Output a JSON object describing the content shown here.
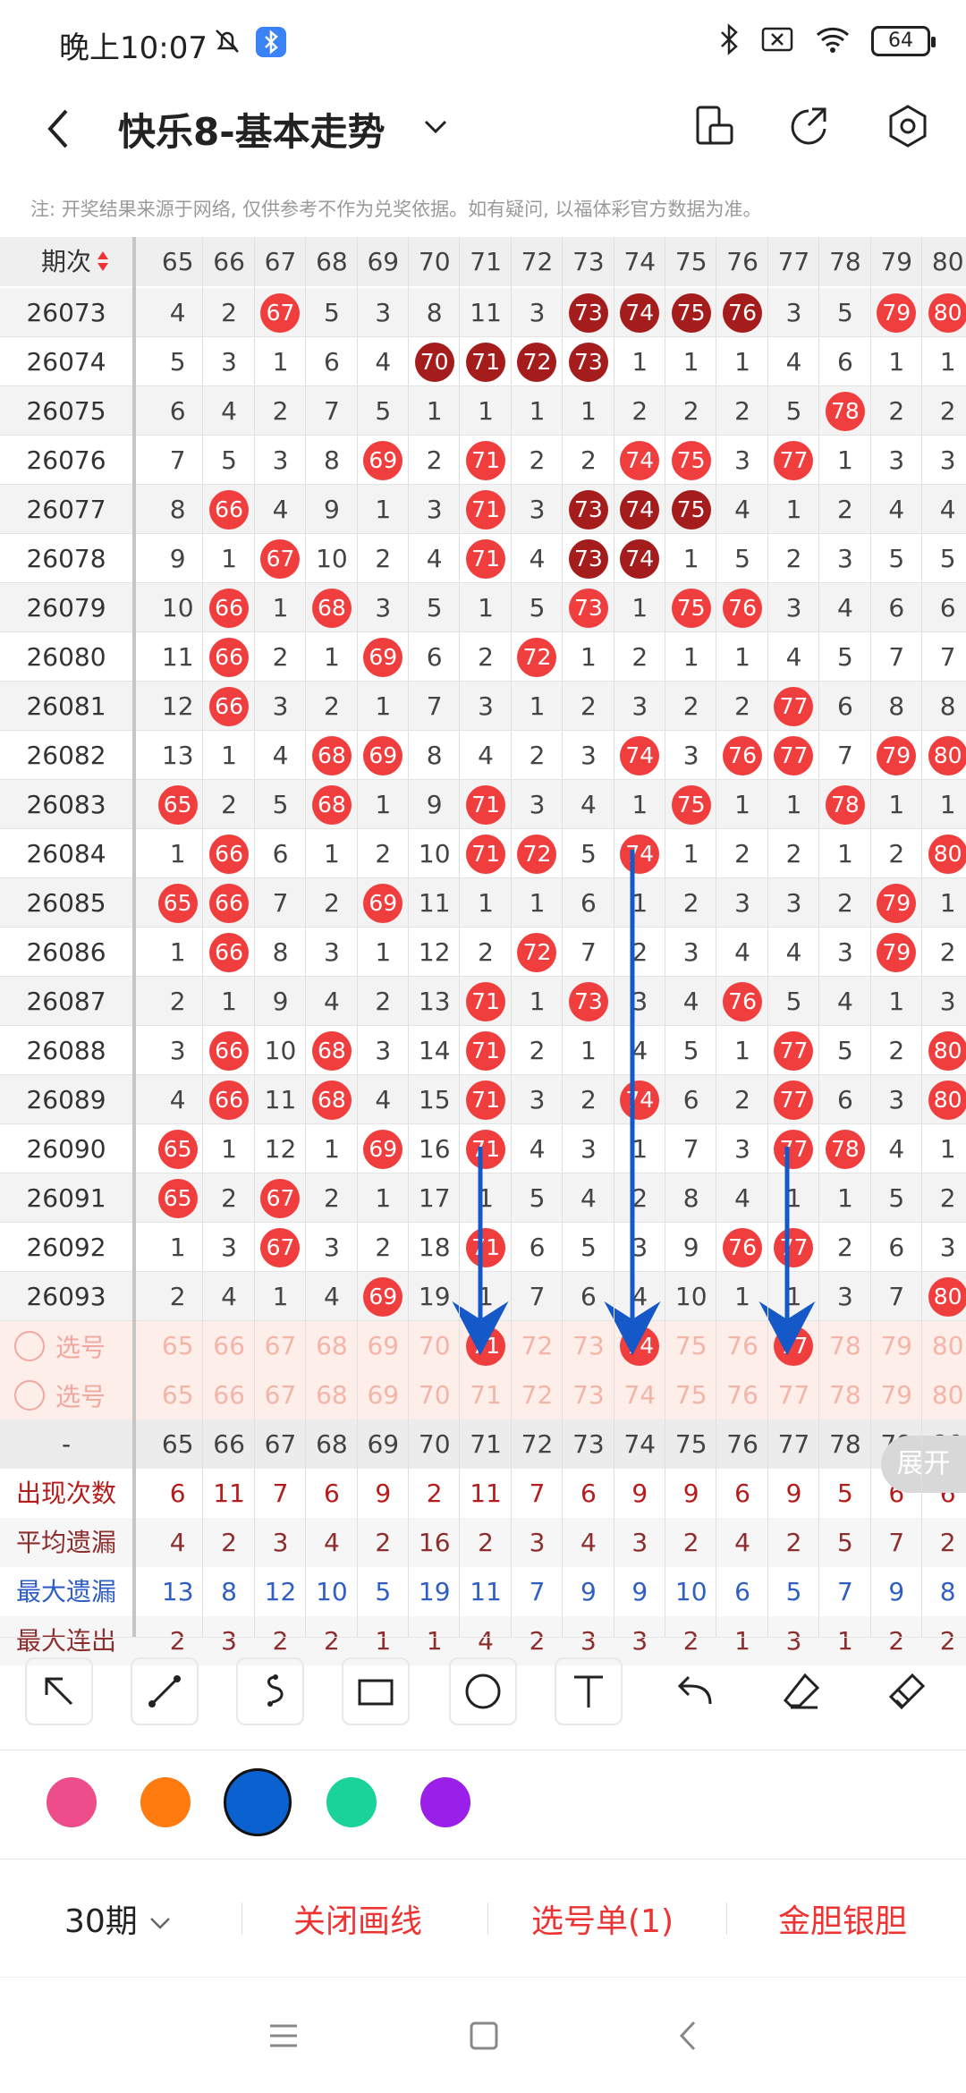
{
  "status_bar": {
    "time": "晚上10:07",
    "battery": "64"
  },
  "header": {
    "title": "快乐8-基本走势"
  },
  "note": "注: 开奖结果来源于网络, 仅供参考不作为兑奖依据。如有疑问, 以福体彩官方数据为准。",
  "table": {
    "period_header": "期次",
    "columns": [
      "65",
      "66",
      "67",
      "68",
      "69",
      "70",
      "71",
      "72",
      "73",
      "74",
      "75",
      "76",
      "77",
      "78",
      "79",
      "80"
    ],
    "rows": [
      {
        "p": "26073",
        "v": [
          "4",
          "2",
          "67",
          "5",
          "3",
          "8",
          "11",
          "3",
          "73",
          "74",
          "75",
          "76",
          "3",
          "5",
          "79",
          "80"
        ]
      },
      {
        "p": "26074",
        "v": [
          "5",
          "3",
          "1",
          "6",
          "4",
          "70",
          "71",
          "72",
          "73",
          "1",
          "1",
          "1",
          "4",
          "6",
          "1",
          "1"
        ]
      },
      {
        "p": "26075",
        "v": [
          "6",
          "4",
          "2",
          "7",
          "5",
          "1",
          "1",
          "1",
          "1",
          "2",
          "2",
          "2",
          "5",
          "78",
          "2",
          "2"
        ]
      },
      {
        "p": "26076",
        "v": [
          "7",
          "5",
          "3",
          "8",
          "69",
          "2",
          "71",
          "2",
          "2",
          "74",
          "75",
          "3",
          "77",
          "1",
          "3",
          "3"
        ]
      },
      {
        "p": "26077",
        "v": [
          "8",
          "66",
          "4",
          "9",
          "1",
          "3",
          "71",
          "3",
          "73",
          "74",
          "75",
          "4",
          "1",
          "2",
          "4",
          "4"
        ]
      },
      {
        "p": "26078",
        "v": [
          "9",
          "1",
          "67",
          "10",
          "2",
          "4",
          "71",
          "4",
          "73",
          "74",
          "1",
          "5",
          "2",
          "3",
          "5",
          "5"
        ]
      },
      {
        "p": "26079",
        "v": [
          "10",
          "66",
          "1",
          "68",
          "3",
          "5",
          "1",
          "5",
          "73",
          "1",
          "75",
          "76",
          "3",
          "4",
          "6",
          "6"
        ]
      },
      {
        "p": "26080",
        "v": [
          "11",
          "66",
          "2",
          "1",
          "69",
          "6",
          "2",
          "72",
          "1",
          "2",
          "1",
          "1",
          "4",
          "5",
          "7",
          "7"
        ]
      },
      {
        "p": "26081",
        "v": [
          "12",
          "66",
          "3",
          "2",
          "1",
          "7",
          "3",
          "1",
          "2",
          "3",
          "2",
          "2",
          "77",
          "6",
          "8",
          "8"
        ]
      },
      {
        "p": "26082",
        "v": [
          "13",
          "1",
          "4",
          "68",
          "69",
          "8",
          "4",
          "2",
          "3",
          "74",
          "3",
          "76",
          "77",
          "7",
          "79",
          "80"
        ]
      },
      {
        "p": "26083",
        "v": [
          "65",
          "2",
          "5",
          "68",
          "1",
          "9",
          "71",
          "3",
          "4",
          "1",
          "75",
          "1",
          "1",
          "78",
          "1",
          "1"
        ]
      },
      {
        "p": "26084",
        "v": [
          "1",
          "66",
          "6",
          "1",
          "2",
          "10",
          "71",
          "72",
          "5",
          "74",
          "1",
          "2",
          "2",
          "1",
          "2",
          "80"
        ]
      },
      {
        "p": "26085",
        "v": [
          "65",
          "66",
          "7",
          "2",
          "69",
          "11",
          "1",
          "1",
          "6",
          "1",
          "2",
          "3",
          "3",
          "2",
          "79",
          "1"
        ]
      },
      {
        "p": "26086",
        "v": [
          "1",
          "66",
          "8",
          "3",
          "1",
          "12",
          "2",
          "72",
          "7",
          "2",
          "3",
          "4",
          "4",
          "3",
          "79",
          "2"
        ]
      },
      {
        "p": "26087",
        "v": [
          "2",
          "1",
          "9",
          "4",
          "2",
          "13",
          "71",
          "1",
          "73",
          "3",
          "4",
          "76",
          "5",
          "4",
          "1",
          "3"
        ]
      },
      {
        "p": "26088",
        "v": [
          "3",
          "66",
          "10",
          "68",
          "3",
          "14",
          "71",
          "2",
          "1",
          "4",
          "5",
          "1",
          "77",
          "5",
          "2",
          "80"
        ]
      },
      {
        "p": "26089",
        "v": [
          "4",
          "66",
          "11",
          "68",
          "4",
          "15",
          "71",
          "3",
          "2",
          "74",
          "6",
          "2",
          "77",
          "6",
          "3",
          "80"
        ]
      },
      {
        "p": "26090",
        "v": [
          "65",
          "1",
          "12",
          "1",
          "69",
          "16",
          "71",
          "4",
          "3",
          "1",
          "7",
          "3",
          "77",
          "78",
          "4",
          "1"
        ]
      },
      {
        "p": "26091",
        "v": [
          "65",
          "2",
          "67",
          "2",
          "1",
          "17",
          "1",
          "5",
          "4",
          "2",
          "8",
          "4",
          "1",
          "1",
          "5",
          "2"
        ]
      },
      {
        "p": "26092",
        "v": [
          "1",
          "3",
          "67",
          "3",
          "2",
          "18",
          "71",
          "6",
          "5",
          "3",
          "9",
          "76",
          "77",
          "2",
          "6",
          "3"
        ]
      },
      {
        "p": "26093",
        "v": [
          "2",
          "4",
          "1",
          "4",
          "69",
          "19",
          "1",
          "7",
          "6",
          "4",
          "10",
          "1",
          "1",
          "3",
          "7",
          "80"
        ]
      }
    ],
    "select_label": "选号",
    "stats_header": "-",
    "stats": [
      {
        "label": "出现次数",
        "v": [
          "6",
          "11",
          "7",
          "6",
          "9",
          "2",
          "11",
          "7",
          "6",
          "9",
          "9",
          "6",
          "9",
          "5",
          "6",
          "6"
        ]
      },
      {
        "label": "平均遗漏",
        "v": [
          "4",
          "2",
          "3",
          "4",
          "2",
          "16",
          "2",
          "3",
          "4",
          "3",
          "2",
          "4",
          "2",
          "5",
          "7",
          "2"
        ]
      },
      {
        "label": "最大遗漏",
        "v": [
          "13",
          "8",
          "12",
          "10",
          "5",
          "19",
          "11",
          "7",
          "9",
          "9",
          "10",
          "6",
          "5",
          "7",
          "9",
          "8"
        ]
      },
      {
        "label": "最大连出",
        "v": [
          "2",
          "3",
          "2",
          "2",
          "1",
          "1",
          "4",
          "2",
          "3",
          "3",
          "2",
          "1",
          "3",
          "1",
          "2",
          "2"
        ]
      }
    ]
  },
  "expand_label": "展开",
  "colors": [
    "#ee4d8b",
    "#ff7a0f",
    "#0a62d1",
    "#19d39a",
    "#9a1fe8"
  ],
  "bottom": {
    "period": "30期",
    "close_draw": "关闭画线",
    "pick_list": "选号单(1)",
    "golden": "金胆银胆"
  }
}
